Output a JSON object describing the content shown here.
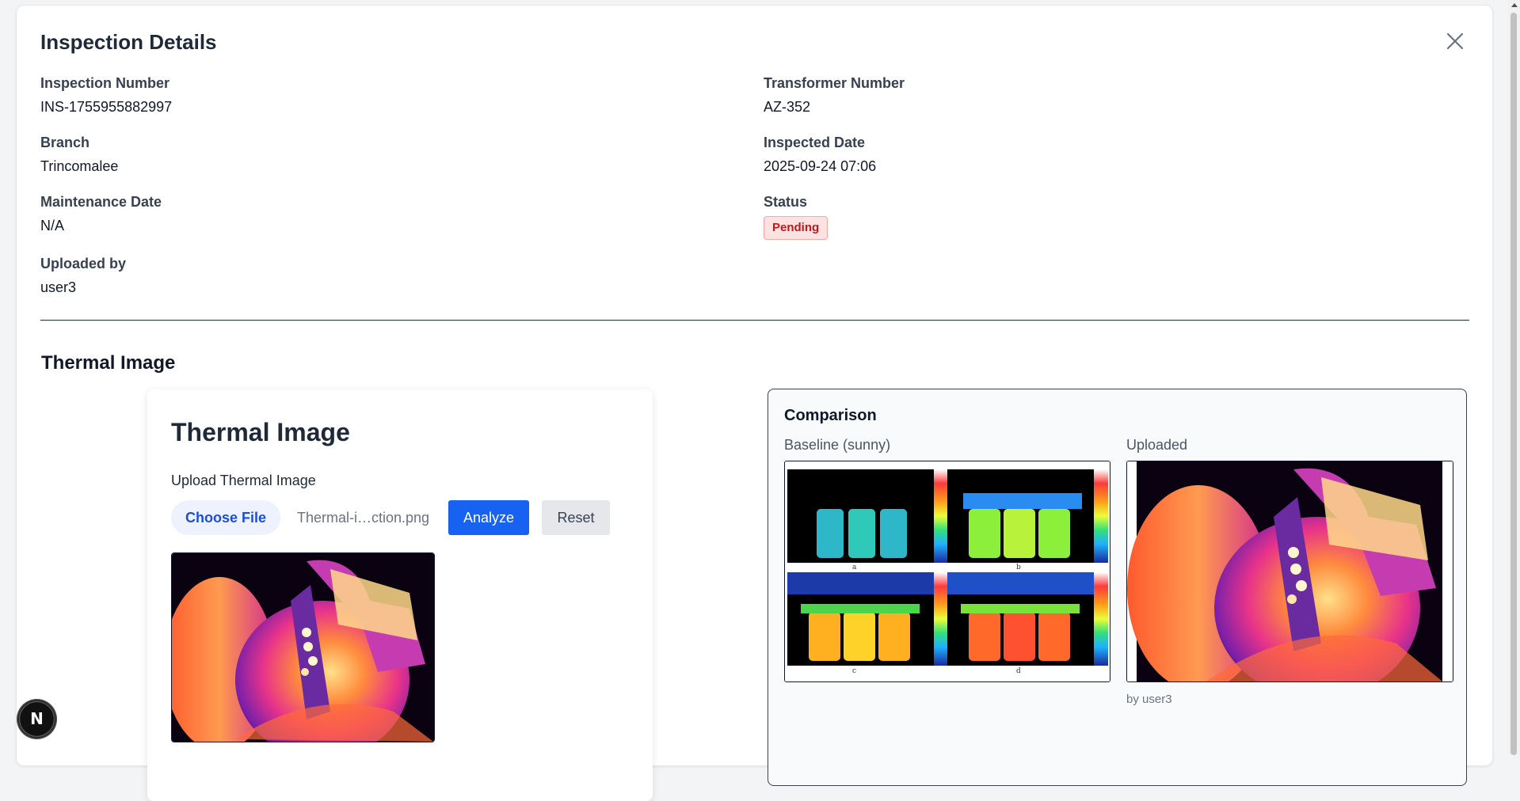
{
  "modal": {
    "title": "Inspection Details",
    "close_icon": "close-icon"
  },
  "details": {
    "inspection_number": {
      "label": "Inspection Number",
      "value": "INS-1755955882997"
    },
    "transformer_number": {
      "label": "Transformer Number",
      "value": "AZ-352"
    },
    "branch": {
      "label": "Branch",
      "value": "Trincomalee"
    },
    "inspected_date": {
      "label": "Inspected Date",
      "value": "2025-09-24 07:06"
    },
    "maintenance_date": {
      "label": "Maintenance Date",
      "value": "N/A"
    },
    "status": {
      "label": "Status",
      "value": "Pending",
      "color": "#b91c1c",
      "background": "#fee2e2"
    },
    "uploaded_by": {
      "label": "Uploaded by",
      "value": "user3"
    }
  },
  "thermal_section": {
    "title": "Thermal Image"
  },
  "upload_card": {
    "title": "Thermal Image",
    "upload_label": "Upload Thermal Image",
    "choose_file_label": "Choose File",
    "file_name": "Thermal-i…ction.png",
    "analyze_label": "Analyze",
    "reset_label": "Reset",
    "accent_color": "#1762f0"
  },
  "comparison": {
    "title": "Comparison",
    "baseline_label": "Baseline (sunny)",
    "uploaded_label": "Uploaded",
    "uploaded_by_caption": "by user3",
    "baseline_panel_labels": [
      "a",
      "b",
      "c",
      "d"
    ]
  },
  "dev_badge": {
    "letter": "N",
    "icon": "nextjs-logo-icon"
  }
}
